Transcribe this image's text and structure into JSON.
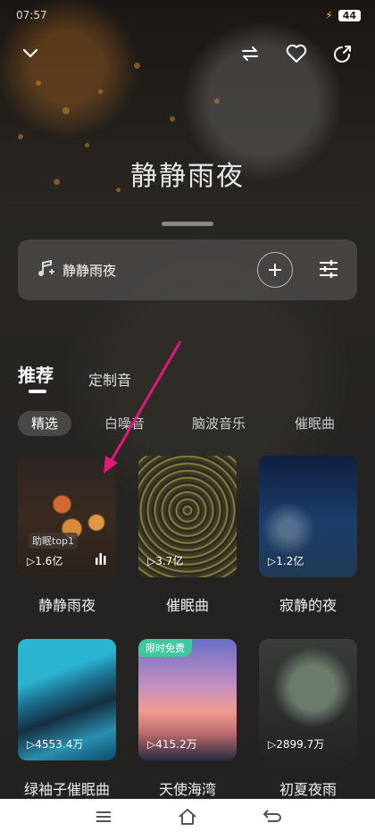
{
  "status_bar": {
    "time": "07:57",
    "battery": "44"
  },
  "header": {
    "title": "静静雨夜"
  },
  "player": {
    "track_name": "静静雨夜"
  },
  "tabs": {
    "main": "推荐",
    "sub": "定制音"
  },
  "chips": [
    "精选",
    "白噪音",
    "脑波音乐",
    "催眠曲"
  ],
  "cards": [
    {
      "plays": "1.6亿",
      "label": "静静雨夜",
      "tag": "助眠top1"
    },
    {
      "plays": "3.7亿",
      "label": "催眠曲"
    },
    {
      "plays": "1.2亿",
      "label": "寂静的夜"
    },
    {
      "plays": "4553.4万",
      "label": "绿袖子催眠曲"
    },
    {
      "plays": "415.2万",
      "label": "天使海湾",
      "badge": "限时免费"
    },
    {
      "plays": "2899.7万",
      "label": "初夏夜雨"
    }
  ],
  "colors": {
    "accent_arrow": "#e0187a",
    "free_badge": "#3fc7a0"
  },
  "icons": [
    "chevron-down-icon",
    "loop-icon",
    "heart-icon",
    "share-icon",
    "music-note-icon",
    "plus-icon",
    "equalizer-icon",
    "play-icon",
    "bars-icon",
    "menu-icon",
    "home-icon",
    "back-icon"
  ]
}
